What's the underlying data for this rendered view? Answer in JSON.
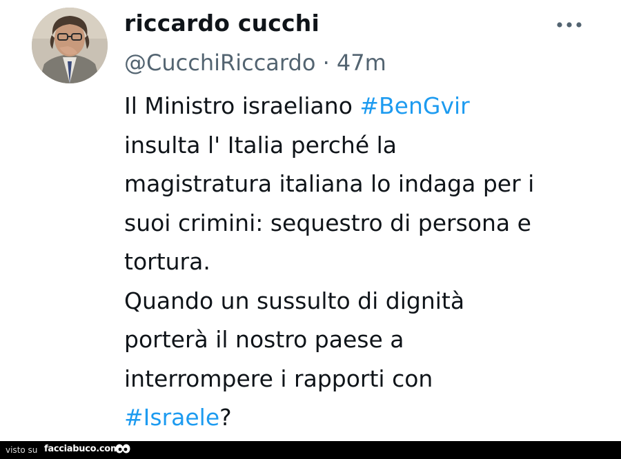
{
  "tweet": {
    "display_name": "riccardo cucchi",
    "handle": "@CucchiRiccardo",
    "separator": "·",
    "time": "47m",
    "more_icon": "more-dots-icon",
    "lines": {
      "l1_text": "Il Ministro israeliano ",
      "l1_hashtag": "#BenGvir",
      "l2": "insulta l' Italia perché la",
      "l3": "magistratura italiana lo indaga per i",
      "l4": "suoi crimini: sequestro di persona e",
      "l5": "tortura.",
      "l6": "Quando un sussulto di dignità",
      "l7": "porterà il nostro paese a",
      "l8": "interrompere i rapporti con",
      "l9_hashtag": "#Israele",
      "l9_text": "?"
    }
  },
  "footer": {
    "visto_su": "visto su",
    "site": "facciabuco.com"
  },
  "colors": {
    "text": "#0f1419",
    "secondary": "#536471",
    "hashtag": "#1d9bf0",
    "footer_bg": "#000000"
  }
}
